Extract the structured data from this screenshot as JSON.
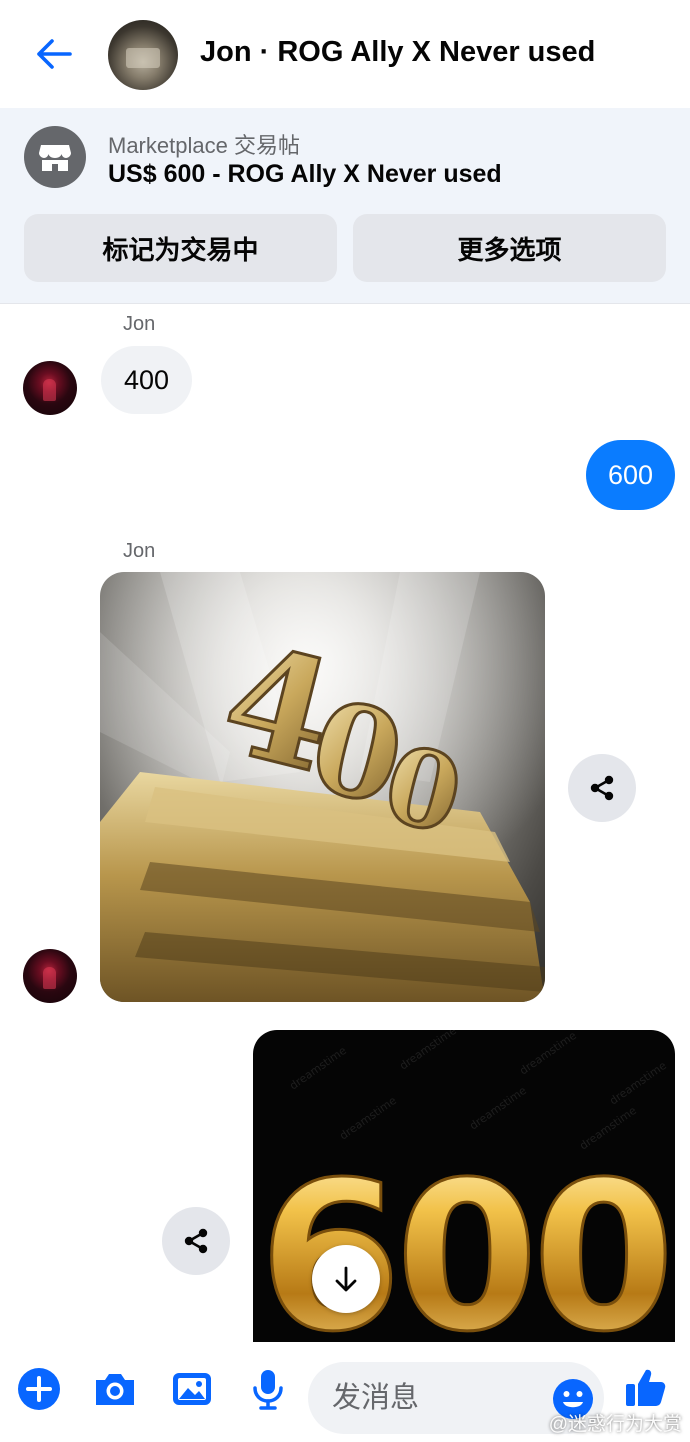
{
  "header": {
    "title": "Jon · ROG Ally X Never used"
  },
  "marketplace": {
    "label": "Marketplace 交易帖",
    "listing_title": "US$ 600 - ROG Ally X Never used",
    "mark_pending_label": "标记为交易中",
    "more_options_label": "更多选项"
  },
  "messages": [
    {
      "sender": "Jon",
      "text": "400"
    },
    {
      "sender": "me",
      "text": "600"
    },
    {
      "sender": "Jon",
      "image_text": "400"
    },
    {
      "sender": "me",
      "image_text": "600"
    }
  ],
  "composer": {
    "placeholder": "发消息"
  },
  "watermark": "@迷惑行为大赏",
  "colors": {
    "accent": "#0a7cff",
    "icon_blue": "#0866ff",
    "incoming_bubble": "#f0f2f5",
    "button_gray": "#e4e6eb",
    "secondary_text": "#65676b"
  },
  "icons": {
    "back": "arrow-left-icon",
    "store": "storefront-icon",
    "share": "share-icon",
    "download": "arrow-down-icon",
    "plus": "plus-circle-icon",
    "camera": "camera-icon",
    "gallery": "image-icon",
    "mic": "microphone-icon",
    "emoji": "smiley-icon",
    "like": "thumbs-up-icon"
  }
}
